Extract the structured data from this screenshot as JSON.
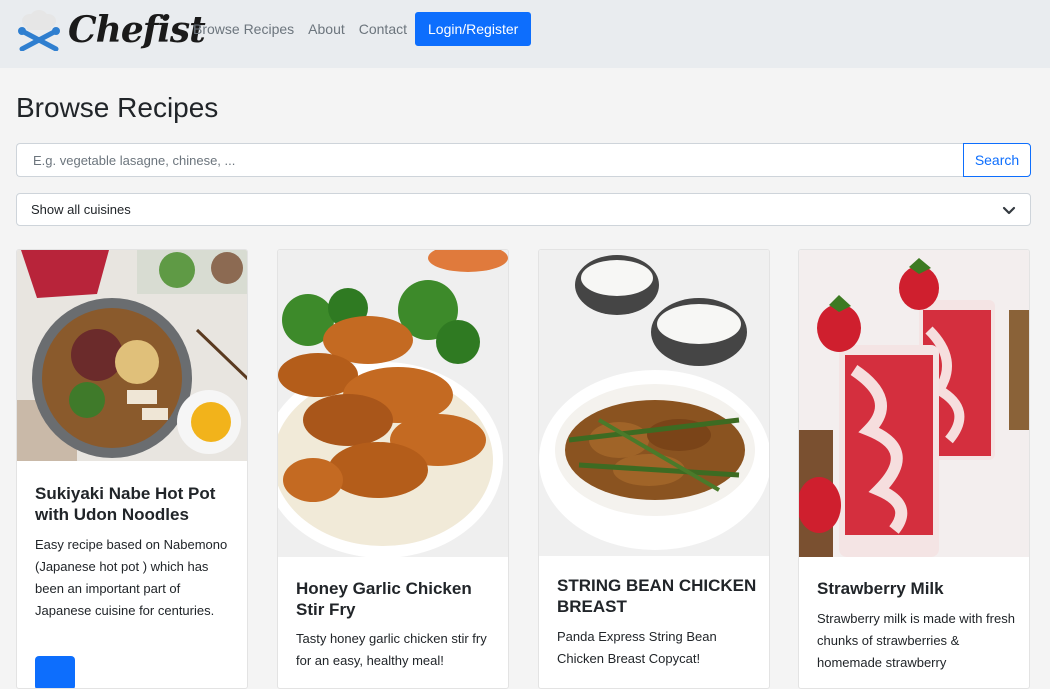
{
  "nav": {
    "brand": "Chefist",
    "links": [
      "Browse Recipes",
      "About",
      "Contact"
    ],
    "login_label": "Login/Register"
  },
  "page": {
    "title": "Browse Recipes"
  },
  "search": {
    "placeholder": "E.g. vegetable lasagne, chinese, ...",
    "value": "",
    "button_label": "Search"
  },
  "filter": {
    "selected": "Show all cuisines"
  },
  "recipes": [
    {
      "title": "Sukiyaki Nabe Hot Pot with Udon Noodles",
      "description": "Easy recipe based on Nabemono (Japanese hot pot ) which has been an important part of Japanese cuisine for centuries."
    },
    {
      "title": "Honey Garlic Chicken Stir Fry",
      "description": "Tasty honey garlic chicken stir fry for an easy, healthy meal!"
    },
    {
      "title": "STRING BEAN CHICKEN BREAST",
      "description": "Panda Express String Bean Chicken Breast Copycat!"
    },
    {
      "title": "Strawberry Milk",
      "description": "Strawberry milk is made with fresh chunks of strawberries & homemade strawberry"
    }
  ],
  "colors": {
    "primary": "#0d6efd",
    "navbar_bg": "#e9ecef",
    "page_bg": "#f4f4f4",
    "logo_blue": "#2f7fd0"
  }
}
